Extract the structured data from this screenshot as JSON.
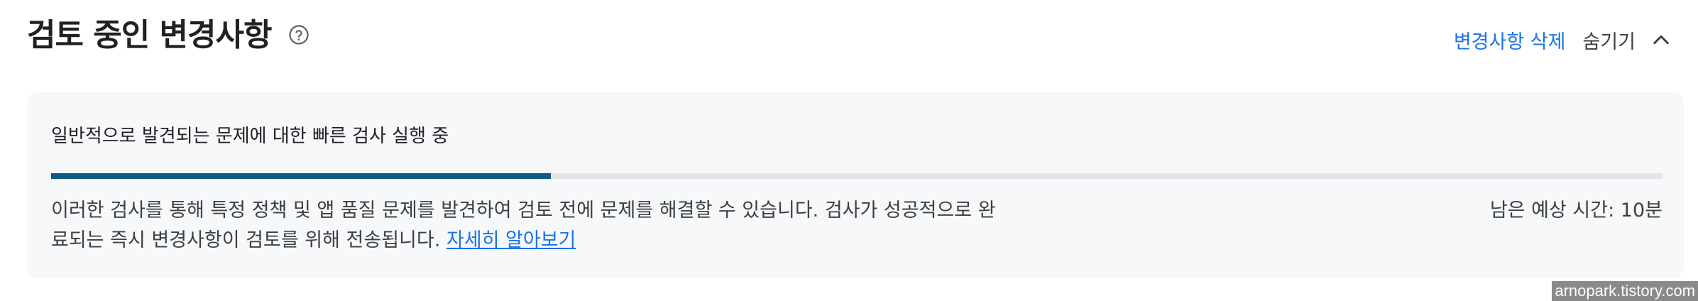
{
  "header": {
    "title": "검토 중인 변경사항",
    "help_icon": "help-circle-icon",
    "delete_label": "변경사항 삭제",
    "hide_label": "숨기기",
    "collapse_icon": "chevron-up-icon"
  },
  "check": {
    "title": "일반적으로 발견되는 문제에 대한 빠른 검사 실행 중",
    "progress_fraction": 0.31,
    "description": "이러한 검사를 통해 특정 정책 및 앱 품질 문제를 발견하여 검토 전에 문제를 해결할 수 있습니다. 검사가 성공적으로 완료되는 즉시 변경사항이 검토를 위해 전송됩니다.",
    "learn_more": "자세히 알아보기",
    "time_remaining": "남은 예상 시간: 10분"
  },
  "watermark": "arnopark.tistory.com",
  "colors": {
    "accent": "#1a73e8",
    "progress": "#0d5a86",
    "card_bg": "#f6f8fa"
  }
}
